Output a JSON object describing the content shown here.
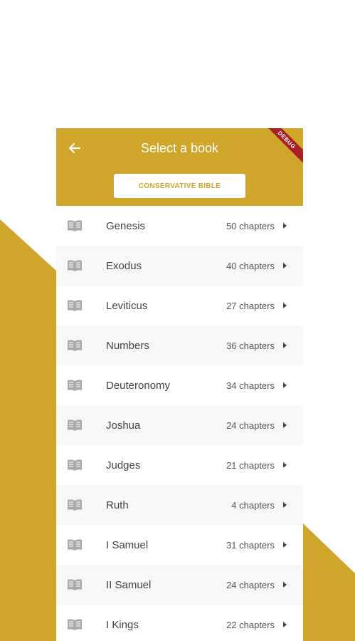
{
  "colors": {
    "accent": "#cfa62a",
    "ribbon": "#a81f24"
  },
  "header": {
    "title": "Select a book",
    "back_icon": "arrow-left-icon",
    "debug_label": "DEBUG",
    "version_button": "CONSERVATIVE BIBLE"
  },
  "books": [
    {
      "name": "Genesis",
      "chapters": "50 chapters"
    },
    {
      "name": "Exodus",
      "chapters": "40 chapters"
    },
    {
      "name": "Leviticus",
      "chapters": "27 chapters"
    },
    {
      "name": "Numbers",
      "chapters": "36 chapters"
    },
    {
      "name": "Deuteronomy",
      "chapters": "34 chapters"
    },
    {
      "name": "Joshua",
      "chapters": "24 chapters"
    },
    {
      "name": "Judges",
      "chapters": "21 chapters"
    },
    {
      "name": "Ruth",
      "chapters": "4 chapters"
    },
    {
      "name": "I Samuel",
      "chapters": "31 chapters"
    },
    {
      "name": "II Samuel",
      "chapters": "24 chapters"
    },
    {
      "name": "I Kings",
      "chapters": "22 chapters"
    }
  ]
}
